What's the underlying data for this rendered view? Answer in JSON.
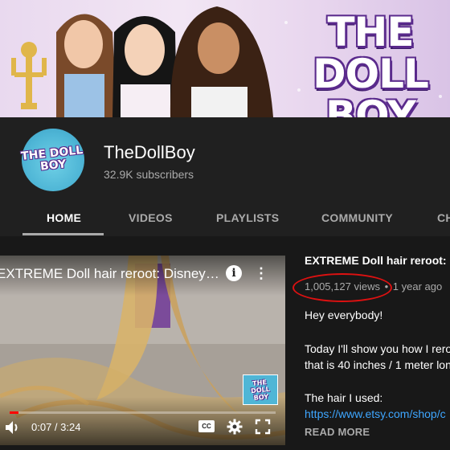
{
  "banner": {
    "title_line1": "THE DOLL",
    "title_line2": "BOY"
  },
  "channel": {
    "name": "TheDollBoy",
    "subscribers": "32.9K subscribers",
    "avatar_line1": "THE DOLL",
    "avatar_line2": "BOY"
  },
  "tabs": [
    {
      "label": "HOME",
      "active": true
    },
    {
      "label": "VIDEOS"
    },
    {
      "label": "PLAYLISTS"
    },
    {
      "label": "COMMUNITY"
    },
    {
      "label": "CH"
    }
  ],
  "player": {
    "title": "EXTREME Doll hair reroot: Disney Store...",
    "time": "0:07 / 3:24",
    "progress": 0.034,
    "watermark_line1": "THE DOLL",
    "watermark_line2": "BOY"
  },
  "video": {
    "title": "EXTREME Doll hair reroot: Dis",
    "views": "1,005,127 views",
    "dot": "•",
    "age": "1 year ago",
    "description": [
      "Hey everybody!",
      "",
      "Today I'll show you how I reroo",
      "that is 40 inches / 1 meter lon",
      "",
      "The hair I used:"
    ],
    "link": "https://www.etsy.com/shop/c",
    "read_more": "READ MORE"
  },
  "colors": {
    "accent_red": "#ff0000",
    "link": "#3ea6ff",
    "highlight_circle": "#dd1111"
  }
}
